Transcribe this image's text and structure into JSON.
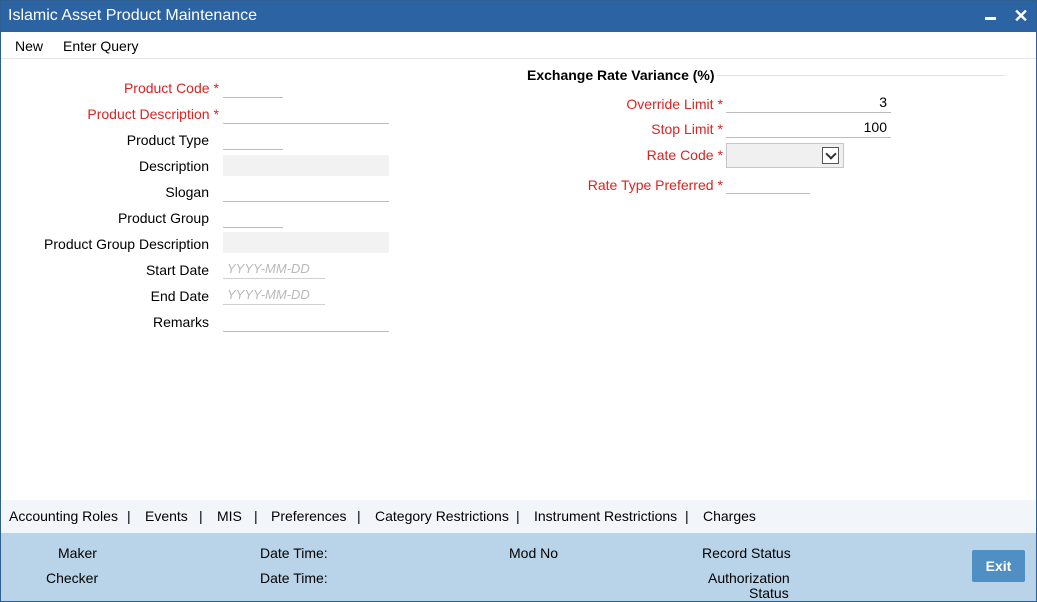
{
  "window": {
    "title": "Islamic Asset Product Maintenance"
  },
  "menu": {
    "new": "New",
    "enter_query": "Enter Query"
  },
  "form": {
    "product_code": {
      "label": "Product Code",
      "value": ""
    },
    "product_description": {
      "label": "Product Description",
      "value": ""
    },
    "product_type": {
      "label": "Product Type",
      "value": ""
    },
    "description": {
      "label": "Description",
      "value": ""
    },
    "slogan": {
      "label": "Slogan",
      "value": ""
    },
    "product_group": {
      "label": "Product Group",
      "value": ""
    },
    "product_group_description": {
      "label": "Product Group Description",
      "value": ""
    },
    "start_date": {
      "label": "Start Date",
      "placeholder": "YYYY-MM-DD"
    },
    "end_date": {
      "label": "End Date",
      "placeholder": "YYYY-MM-DD"
    },
    "remarks": {
      "label": "Remarks",
      "value": ""
    }
  },
  "exchange": {
    "title": "Exchange Rate Variance (%)",
    "override_limit": {
      "label": "Override Limit",
      "value": "3"
    },
    "stop_limit": {
      "label": "Stop Limit",
      "value": "100"
    },
    "rate_code": {
      "label": "Rate Code",
      "value": ""
    },
    "rate_type_preferred": {
      "label": "Rate Type Preferred",
      "value": ""
    }
  },
  "required_marker": "*",
  "tabs": [
    "Accounting Roles",
    "Events",
    "MIS",
    "Preferences",
    "Category Restrictions",
    "Instrument Restrictions",
    "Charges"
  ],
  "tab_separator": "|",
  "footer": {
    "maker": "Maker",
    "checker": "Checker",
    "date_time_1": "Date Time:",
    "date_time_2": "Date Time:",
    "mod_no": "Mod No",
    "record_status": "Record Status",
    "authorization_status_line1": "Authorization",
    "authorization_status_line2": "Status",
    "exit": "Exit"
  },
  "colors": {
    "titlebar": "#2b63a3",
    "required": "#e0211f",
    "footer": "#b9d3e8",
    "exit_button": "#4f8fc4"
  }
}
